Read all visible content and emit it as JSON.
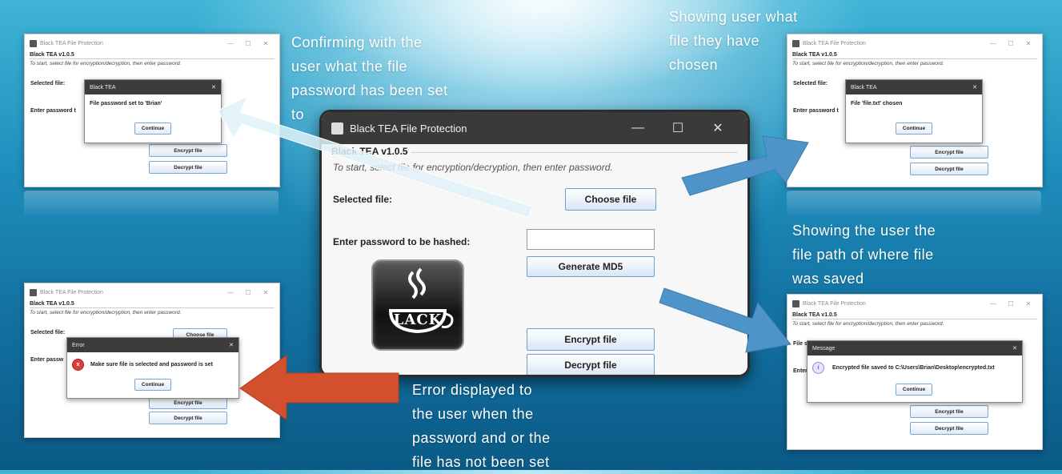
{
  "app": {
    "window_title": "Black TEA File Protection",
    "version_label": "Black TEA v1.0.5",
    "hint": "To start, select file for encryption/decryption, then enter password.",
    "selected_file_label": "Selected file:",
    "password_label": "Enter password to be hashed:",
    "choose_file": "Choose file",
    "generate_md5": "Generate MD5",
    "encrypt_file": "Encrypt file",
    "decrypt_file": "Decrypt file",
    "logo_text": "LACK",
    "minimize": "—",
    "maximize": "☐",
    "close": "✕"
  },
  "mini": {
    "window_title": "Black TEA File Protection",
    "version_label": "Black TEA v1.0.5",
    "hint": "To start, select file for encryption/decryption, then enter password.",
    "selected_file_label": "Selected file:",
    "selected_file_label_short": "Selected file:",
    "password_label_short": "Enter password t",
    "password_label_short2": "Enter passw",
    "file_label_short": "File s",
    "password_label_short3": "Enter",
    "choose_file": "Choose file",
    "encrypt_file": "Encrypt file",
    "decrypt_file": "Decrypt file",
    "minimize": "—",
    "maximize": "☐",
    "close": "✕"
  },
  "dialogs": {
    "password_set": {
      "title": "Black TEA",
      "message": "File password set to 'Brian'",
      "button": "Continue"
    },
    "file_chosen": {
      "title": "Black TEA",
      "message": "File 'file.txt' chosen",
      "button": "Continue"
    },
    "error": {
      "title": "Error",
      "message": "Make sure file is selected and password is set",
      "button": "Continue"
    },
    "saved": {
      "title": "Message",
      "message": "Encrypted file saved to C:\\Users\\Brian\\Desktop\\encrypted.txt",
      "button": "Continue"
    }
  },
  "captions": {
    "top_left": [
      "Confirming with the",
      "user what the file",
      "password has been set",
      "to"
    ],
    "top_right": [
      "Showing user what",
      "file they have",
      "chosen"
    ],
    "mid_right": [
      "Showing the user the",
      "file path of where file",
      "was saved"
    ],
    "bottom": [
      "Error displayed to",
      "the user when the",
      "password and or the",
      "file has not been set"
    ]
  },
  "colors": {
    "blue_arrow": "#4f94c8",
    "red_arrow": "#d2502e",
    "light_arrow": "#dff2f8"
  }
}
